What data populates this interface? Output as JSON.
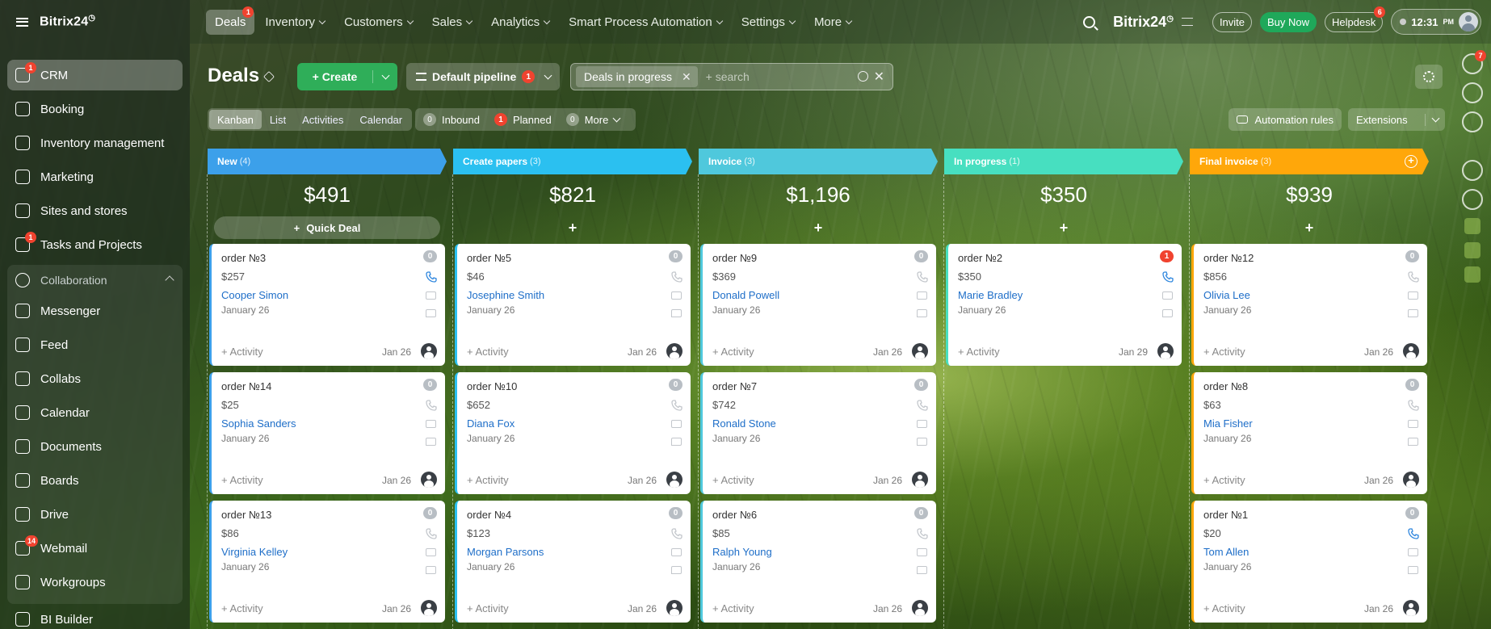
{
  "brand": {
    "name": "Bitrix24",
    "clock_glyph": "◷"
  },
  "sidebar": {
    "items": [
      {
        "label": "CRM",
        "icon": "crm-icon",
        "badge": "1",
        "active": true
      },
      {
        "label": "Booking",
        "icon": "booking-icon"
      },
      {
        "label": "Inventory management",
        "icon": "inventory-icon"
      },
      {
        "label": "Marketing",
        "icon": "marketing-icon"
      },
      {
        "label": "Sites and stores",
        "icon": "cart-icon"
      },
      {
        "label": "Tasks and Projects",
        "icon": "tasks-icon",
        "badge": "1"
      }
    ],
    "group": {
      "label": "Collaboration",
      "items": [
        {
          "label": "Messenger",
          "icon": "messenger-icon"
        },
        {
          "label": "Feed",
          "icon": "feed-icon"
        },
        {
          "label": "Collabs",
          "icon": "collabs-icon"
        },
        {
          "label": "Calendar",
          "icon": "calendar-icon"
        },
        {
          "label": "Documents",
          "icon": "documents-icon"
        },
        {
          "label": "Boards",
          "icon": "boards-icon"
        },
        {
          "label": "Drive",
          "icon": "drive-icon"
        },
        {
          "label": "Webmail",
          "icon": "webmail-icon",
          "badge": "14"
        },
        {
          "label": "Workgroups",
          "icon": "workgroups-icon"
        }
      ]
    },
    "after": [
      {
        "label": "BI Builder",
        "icon": "bi-builder-icon"
      }
    ]
  },
  "topmenu": [
    {
      "label": "Deals",
      "badge": "1",
      "active": true
    },
    {
      "label": "Inventory",
      "chevron": true
    },
    {
      "label": "Customers",
      "chevron": true
    },
    {
      "label": "Sales",
      "chevron": true
    },
    {
      "label": "Analytics",
      "chevron": true
    },
    {
      "label": "Smart Process Automation",
      "chevron": true
    },
    {
      "label": "Settings",
      "chevron": true
    },
    {
      "label": "More",
      "chevron": true
    }
  ],
  "topright": {
    "brand": "Bitrix24",
    "invite": "Invite",
    "buy_now": "Buy Now",
    "helpdesk": "Helpdesk",
    "helpdesk_badge": "6",
    "time": "12:31",
    "time_suffix": "PM"
  },
  "rail": {
    "notifications_badge": "7"
  },
  "toolbar": {
    "title": "Deals",
    "create": "Create",
    "pipeline": "Default pipeline",
    "pipeline_badge": "1",
    "filter_tag": "Deals in progress",
    "search_placeholder": "+ search"
  },
  "views": [
    "Kanban",
    "List",
    "Activities",
    "Calendar"
  ],
  "counters": [
    {
      "count": "0",
      "label": "Inbound",
      "red": false
    },
    {
      "count": "1",
      "label": "Planned",
      "red": true
    },
    {
      "count": "0",
      "label": "More",
      "red": false,
      "chevron": true
    }
  ],
  "automation_rules": "Automation rules",
  "extensions": "Extensions",
  "quick_deal": "Quick Deal",
  "activity_label": "+ Activity",
  "colors": {
    "new": "#3ca0ea",
    "create_papers": "#2bc0f0",
    "invoice": "#4fc8dc",
    "in_progress": "#47dfc0",
    "final_invoice": "#ffa70a"
  },
  "columns": [
    {
      "name": "New",
      "count": "(4)",
      "sum": "$491",
      "color": "#3ca0ea",
      "quick": true,
      "cards": [
        {
          "title": "order №3",
          "amount": "$257",
          "client": "Cooper Simon",
          "date": "January 26",
          "due": "Jan 26",
          "badge": "0",
          "phone_active": true
        },
        {
          "title": "order №14",
          "amount": "$25",
          "client": "Sophia Sanders",
          "date": "January 26",
          "due": "Jan 26",
          "badge": "0"
        },
        {
          "title": "order №13",
          "amount": "$86",
          "client": "Virginia Kelley",
          "date": "January 26",
          "due": "Jan 26",
          "badge": "0"
        }
      ]
    },
    {
      "name": "Create papers",
      "count": "(3)",
      "sum": "$821",
      "color": "#2bc0f0",
      "cards": [
        {
          "title": "order №5",
          "amount": "$46",
          "client": "Josephine Smith",
          "date": "January 26",
          "due": "Jan 26",
          "badge": "0"
        },
        {
          "title": "order №10",
          "amount": "$652",
          "client": "Diana Fox",
          "date": "January 26",
          "due": "Jan 26",
          "badge": "0"
        },
        {
          "title": "order №4",
          "amount": "$123",
          "client": "Morgan Parsons",
          "date": "January 26",
          "due": "Jan 26",
          "badge": "0"
        }
      ]
    },
    {
      "name": "Invoice",
      "count": "(3)",
      "sum": "$1,196",
      "color": "#4fc8dc",
      "cards": [
        {
          "title": "order №9",
          "amount": "$369",
          "client": "Donald Powell",
          "date": "January 26",
          "due": "Jan 26",
          "badge": "0"
        },
        {
          "title": "order №7",
          "amount": "$742",
          "client": "Ronald Stone",
          "date": "January 26",
          "due": "Jan 26",
          "badge": "0"
        },
        {
          "title": "order №6",
          "amount": "$85",
          "client": "Ralph Young",
          "date": "January 26",
          "due": "Jan 26",
          "badge": "0"
        }
      ]
    },
    {
      "name": "In progress",
      "count": "(1)",
      "sum": "$350",
      "color": "#47dfc0",
      "cards": [
        {
          "title": "order №2",
          "amount": "$350",
          "client": "Marie Bradley",
          "date": "January 26",
          "due": "Jan 29",
          "badge": "1",
          "badge_red": true,
          "phone_active": true
        }
      ]
    },
    {
      "name": "Final invoice",
      "count": "(3)",
      "sum": "$939",
      "color": "#ffa70a",
      "add_circle": true,
      "cards": [
        {
          "title": "order №12",
          "amount": "$856",
          "client": "Olivia Lee",
          "date": "January 26",
          "due": "Jan 26",
          "badge": "0"
        },
        {
          "title": "order №8",
          "amount": "$63",
          "client": "Mia Fisher",
          "date": "January 26",
          "due": "Jan 26",
          "badge": "0"
        },
        {
          "title": "order №1",
          "amount": "$20",
          "client": "Tom Allen",
          "date": "January 26",
          "due": "Jan 26",
          "badge": "0",
          "phone_active": true
        }
      ]
    }
  ]
}
